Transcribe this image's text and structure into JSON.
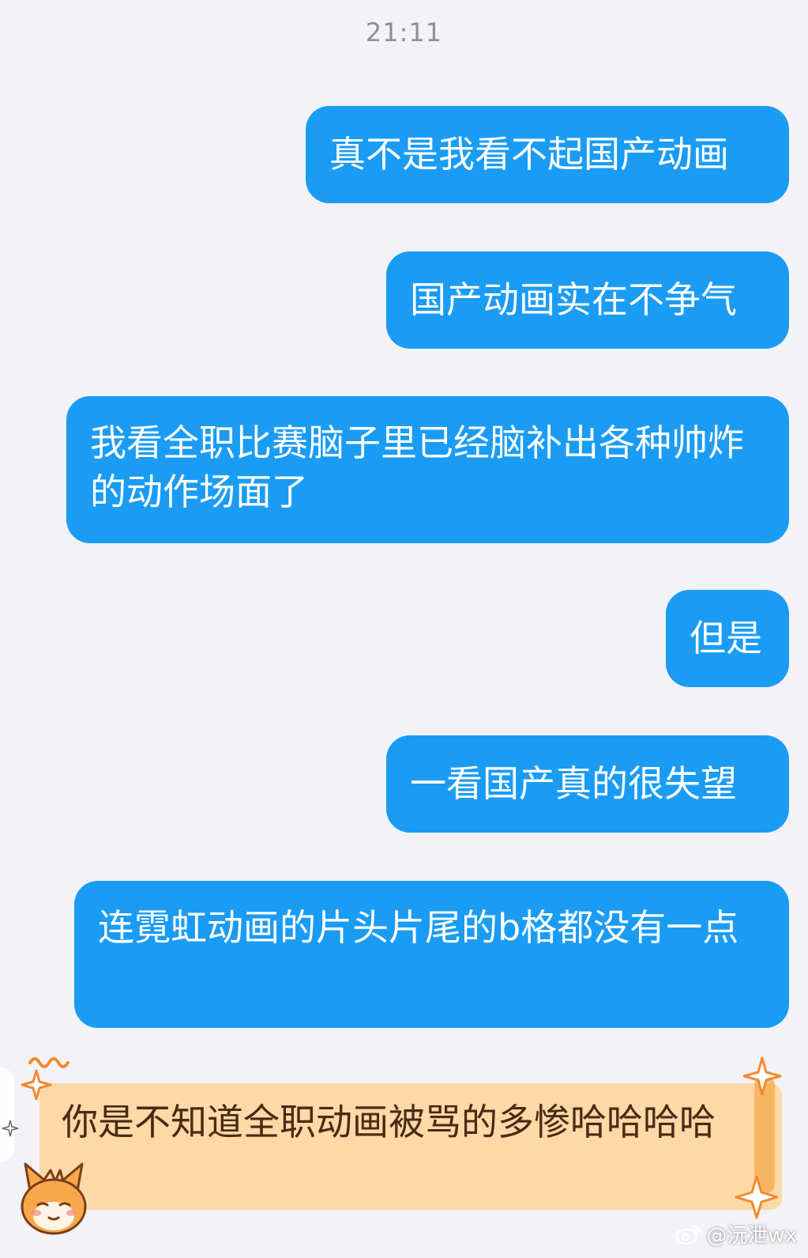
{
  "chat": {
    "timestamp": "21:11",
    "messages": [
      "真不是我看不起国产动画",
      "国产动画实在不争气",
      "我看全职比赛脑子里已经脑补出各种帅炸的动作场面了",
      "但是",
      "一看国产真的很失望",
      "连霓虹动画的片头片尾的b格都没有一点"
    ],
    "reply_card_text": "你是不知道全职动画被骂的多惨哈哈哈哈"
  },
  "watermark": {
    "text": "@沅泄wx",
    "icon": "weibo-icon"
  },
  "colors": {
    "background": "#f2f2f7",
    "bubble": "#1a9cf4",
    "bubble_text": "#ffffff",
    "card": "#fcd9a6",
    "card_text": "#4a2a14",
    "sparkle": "#f28a2e"
  }
}
